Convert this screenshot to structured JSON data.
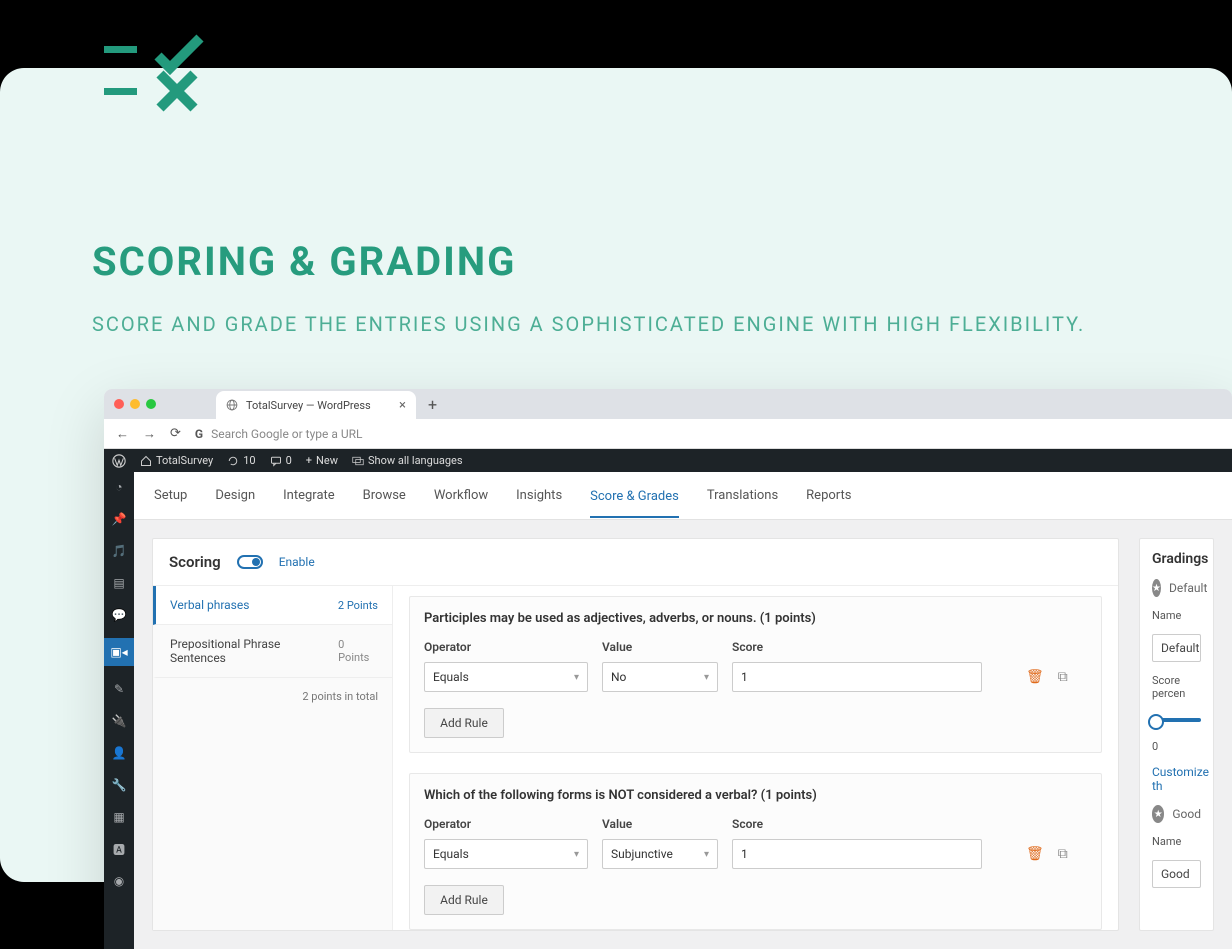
{
  "hero": {
    "title": "SCORING & GRADING",
    "subtitle": "SCORE AND GRADE THE ENTRIES USING A SOPHISTICATED ENGINE WITH HIGH FLEXIBILITY."
  },
  "browser_tab": "TotalSurvey — WordPress",
  "url_placeholder": "Search Google or type a URL",
  "wp_bar": {
    "site": "TotalSurvey",
    "updates": "10",
    "comments": "0",
    "new": "New",
    "languages": "Show all languages"
  },
  "app_tabs": [
    "Setup",
    "Design",
    "Integrate",
    "Browse",
    "Workflow",
    "Insights",
    "Score & Grades",
    "Translations",
    "Reports"
  ],
  "active_tab": "Score & Grades",
  "scoring": {
    "title": "Scoring",
    "enable": "Enable",
    "sections": [
      {
        "name": "Verbal phrases",
        "points": "2 Points"
      },
      {
        "name": "Prepositional Phrase Sentences",
        "points": "0 Points"
      }
    ],
    "total": "2 points in total",
    "questions": [
      {
        "title": "Participles may be used as adjectives, adverbs, or nouns. (1 points)",
        "labels": {
          "op": "Operator",
          "val": "Value",
          "score": "Score"
        },
        "operator": "Equals",
        "value": "No",
        "score": "1",
        "add_rule": "Add Rule"
      },
      {
        "title": "Which of the following forms is NOT considered a verbal? (1 points)",
        "labels": {
          "op": "Operator",
          "val": "Value",
          "score": "Score"
        },
        "operator": "Equals",
        "value": "Subjunctive",
        "score": "1",
        "add_rule": "Add Rule"
      }
    ]
  },
  "gradings": {
    "title": "Gradings",
    "items": [
      {
        "chip": "Default",
        "name_label": "Name",
        "name_value": "Default",
        "percent_label": "Score percen",
        "percent_value": "0",
        "customize": "Customize th"
      },
      {
        "chip": "Good",
        "name_label": "Name",
        "name_value": "Good"
      }
    ]
  }
}
